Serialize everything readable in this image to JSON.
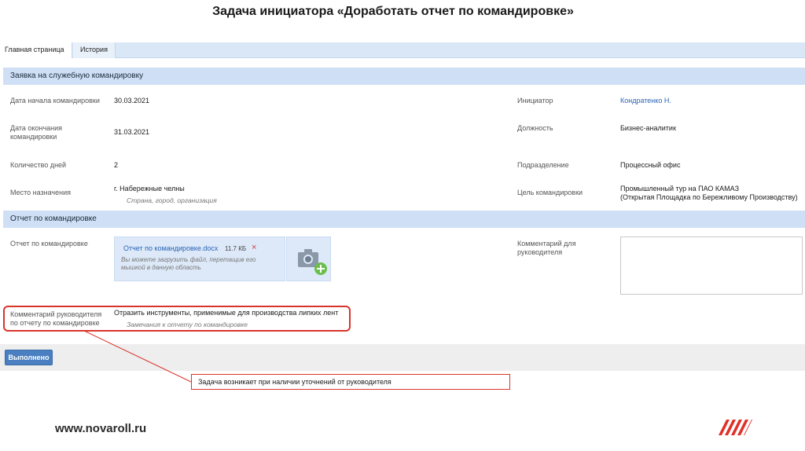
{
  "slide": {
    "title": "Задача инициатора «Доработать отчет по командировке»",
    "site": "www.novaroll.ru"
  },
  "tabs": [
    {
      "label": "Главная страница",
      "active": true
    },
    {
      "label": "История",
      "active": false
    }
  ],
  "trip_section": {
    "header": "Заявка на служебную командировку",
    "start_label": "Дата начала командировки",
    "start_value": "30.03.2021",
    "end_label": "Дата окончания командировки",
    "end_value": "31.03.2021",
    "days_label": "Количество дней",
    "days_value": "2",
    "destination_label": "Место назначения",
    "destination_value": "г. Набережные челны",
    "destination_hint": "Страна, город, организация",
    "initiator_label": "Инициатор",
    "initiator_value": "Кондратенко Н.",
    "position_label": "Должность",
    "position_value": "Бизнес-аналитик",
    "department_label": "Подразделение",
    "department_value": "Процессный офис",
    "purpose_label": "Цель командировки",
    "purpose_value_line1": "Промышленный тур на ПАО КАМАЗ",
    "purpose_value_line2": "(Открытая Площадка по Бережливому Производству)"
  },
  "report_section": {
    "header": "Отчет по командировке",
    "report_label": "Отчет по командировке",
    "file_name": "Отчет по командировке.docx",
    "file_size": "11.7 КБ",
    "remove_icon": "×",
    "upload_hint": "Вы можете загрузить файл, перетащив его мышкой в данную область",
    "comment_label": "Комментарий для руководителя",
    "manager_comment_label": "Комментарий руководителя по отчету по командировке",
    "manager_comment_value": "Отразить инструменты, применимые для производства липких лент",
    "manager_comment_hint": "Замечания к отчету по командировке"
  },
  "actions": {
    "done_label": "Выполнено"
  },
  "callout": {
    "text": "Задача возникает при наличии уточнений от руководителя"
  },
  "colors": {
    "accent": "#4a7fc1",
    "section_bg": "#cfe0f6",
    "highlight": "#d9342b",
    "link": "#2a63b5"
  }
}
